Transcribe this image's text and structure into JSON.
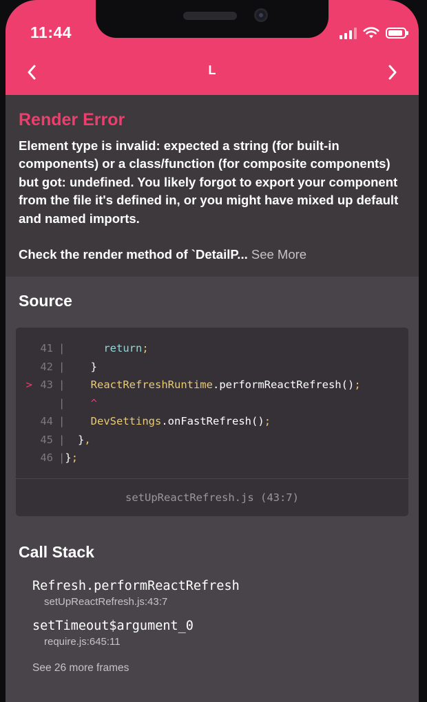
{
  "status_bar": {
    "time": "11:44",
    "icons": [
      "signal-icon",
      "wifi-icon",
      "battery-icon"
    ]
  },
  "header": {
    "title": "L",
    "prev_icon": "chevron-left-icon",
    "next_icon": "chevron-right-icon",
    "background_color": "#ee3e6d"
  },
  "error": {
    "title": "Render Error",
    "message": "Element type is invalid: expected a string (for built-in components) or a class/function (for composite components) but got: undefined. You likely forgot to export your component from the file it's defined in, or you might have mixed up default and named imports.",
    "check_text": "Check the render method of `DetailP...",
    "see_more_label": "See More",
    "title_color": "#ee3e6d"
  },
  "source": {
    "title": "Source",
    "lines": [
      {
        "marker": "",
        "num": "41",
        "code": "      return;"
      },
      {
        "marker": "",
        "num": "42",
        "code": "    }"
      },
      {
        "marker": ">",
        "num": "43",
        "code": "    ReactRefreshRuntime.performReactRefresh();"
      },
      {
        "marker": "",
        "num": "",
        "code": "    ^"
      },
      {
        "marker": "",
        "num": "44",
        "code": "    DevSettings.onFastRefresh();"
      },
      {
        "marker": "",
        "num": "45",
        "code": "  },"
      },
      {
        "marker": "",
        "num": "46",
        "code": "};"
      }
    ],
    "file_location": "setUpReactRefresh.js (43:7)"
  },
  "call_stack": {
    "title": "Call Stack",
    "frames": [
      {
        "name": "Refresh.performReactRefresh",
        "location": "setUpReactRefresh.js:43:7"
      },
      {
        "name": "setTimeout$argument_0",
        "location": "require.js:645:11"
      }
    ],
    "more_frames_label": "See 26 more frames"
  }
}
